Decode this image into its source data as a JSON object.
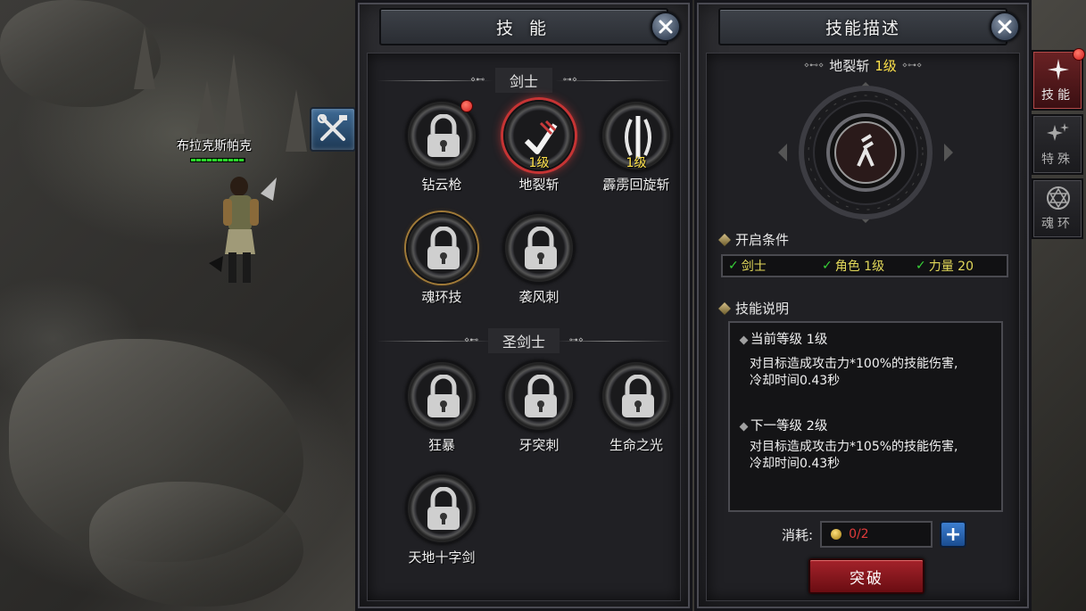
{
  "player": {
    "name": "布拉克斯帕克"
  },
  "skills_panel": {
    "title": "技 能",
    "sections": [
      {
        "label": "剑士",
        "skills": [
          {
            "name": "钻云枪",
            "level": "",
            "state": "locked",
            "has_alert": true
          },
          {
            "name": "地裂斩",
            "level": "1级",
            "state": "selected",
            "has_alert": false
          },
          {
            "name": "霹雳回旋斩",
            "level": "1级",
            "state": "unlocked",
            "has_alert": false
          },
          {
            "name": "魂环技",
            "level": "",
            "state": "locked-gold",
            "has_alert": false
          },
          {
            "name": "袭风刺",
            "level": "",
            "state": "locked",
            "has_alert": false
          }
        ]
      },
      {
        "label": "圣剑士",
        "skills": [
          {
            "name": "狂暴",
            "level": "",
            "state": "locked",
            "has_alert": false
          },
          {
            "name": "牙突刺",
            "level": "",
            "state": "locked",
            "has_alert": false
          },
          {
            "name": "生命之光",
            "level": "",
            "state": "locked",
            "has_alert": false
          },
          {
            "name": "天地十字剑",
            "level": "",
            "state": "locked",
            "has_alert": false
          }
        ]
      }
    ]
  },
  "desc_panel": {
    "title": "技能描述",
    "skill_name": "地裂斩",
    "skill_level": "1级",
    "conditions_label": "开启条件",
    "conditions": [
      {
        "text": "剑士",
        "met": true
      },
      {
        "text": "角色 1级",
        "met": true
      },
      {
        "text": "力量 20",
        "met": true
      }
    ],
    "description_label": "技能说明",
    "current_level_label": "当前等级 1级",
    "current_effect_line1": "对目标造成攻击力*100%的技能伤害,",
    "current_effect_line2": "冷却时间0.43秒",
    "next_level_label": "下一等级 2级",
    "next_effect_line1": "对目标造成攻击力*105%的技能伤害,",
    "next_effect_line2": "冷却时间0.43秒",
    "cost_label": "消耗:",
    "cost_value": "0/2",
    "plus_label": "+",
    "breakthrough_label": "突破"
  },
  "right_tabs": [
    {
      "label": "技能",
      "icon": "star-icon",
      "active": true,
      "has_alert": true
    },
    {
      "label": "特殊",
      "icon": "sparkle-icon",
      "active": false,
      "has_alert": false
    },
    {
      "label": "魂环",
      "icon": "hexagram-icon",
      "active": false,
      "has_alert": false
    }
  ],
  "colors": {
    "level_yellow": "#ffe24a",
    "alert_red": "#d01f1f",
    "check_green": "#38d238",
    "cost_red": "#e03a3a"
  }
}
